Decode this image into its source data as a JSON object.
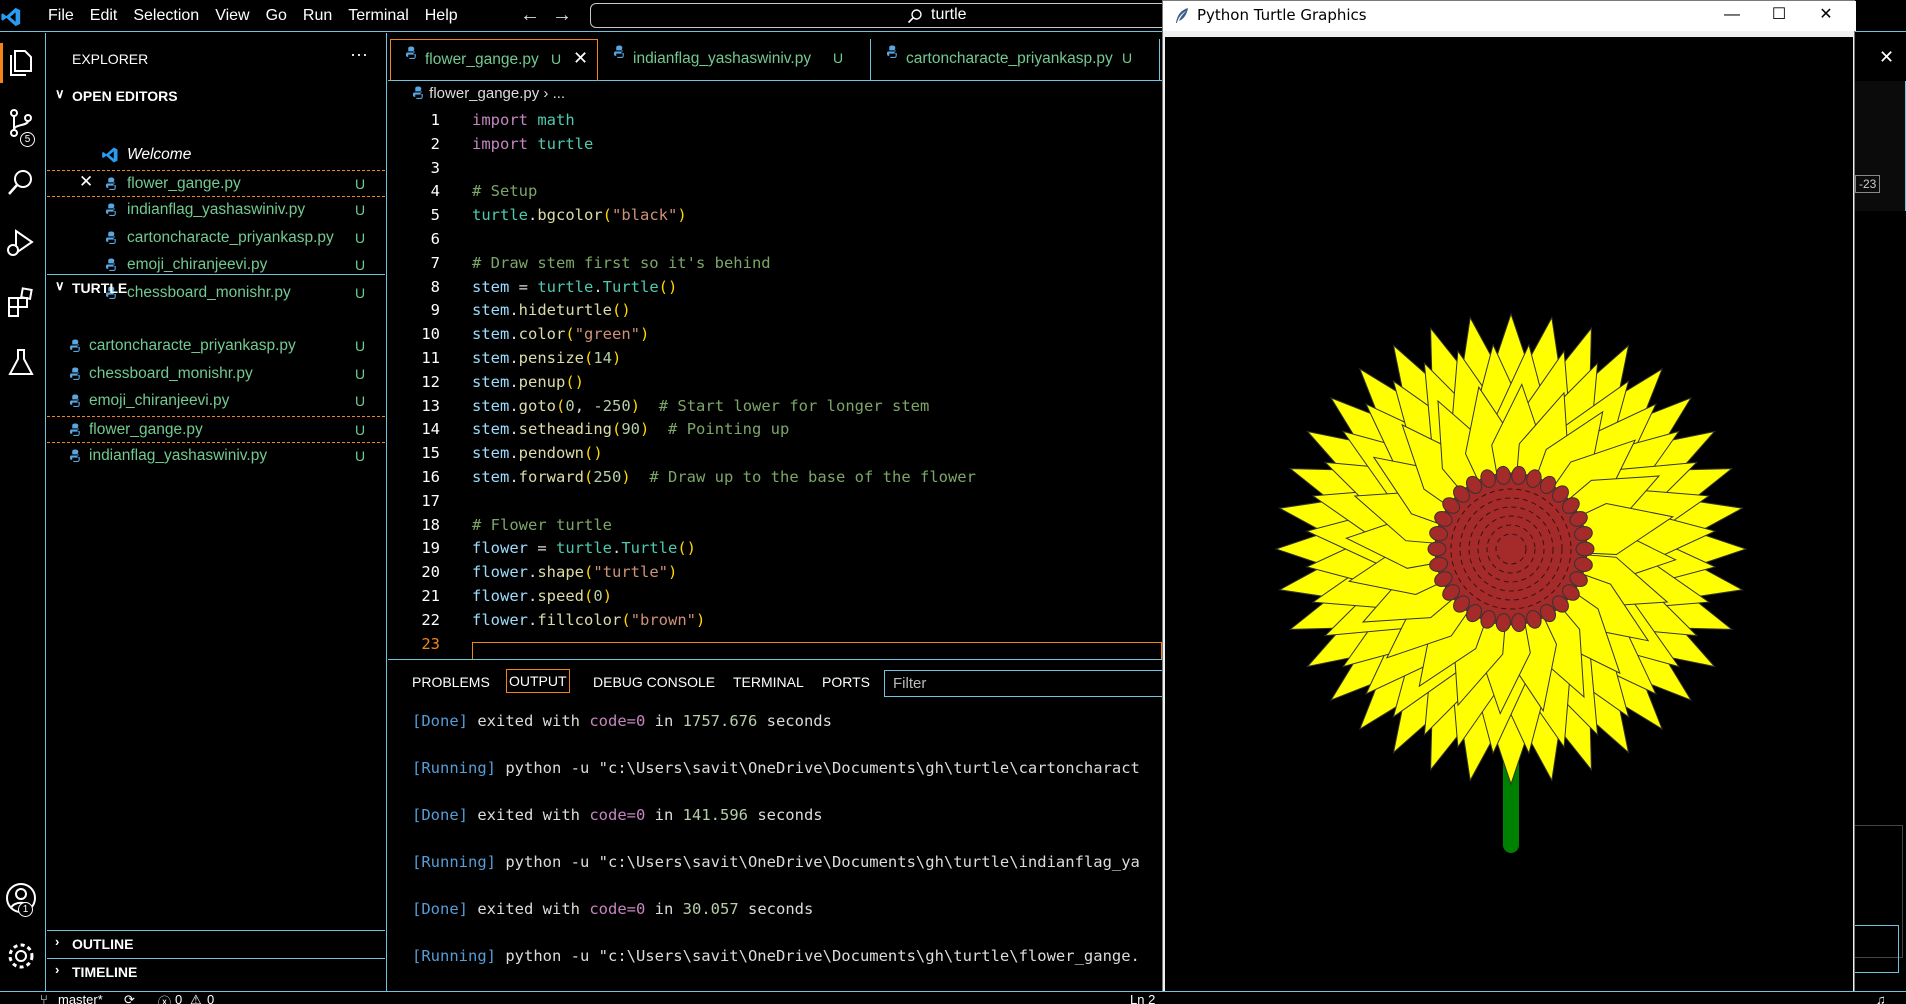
{
  "menu": [
    "File",
    "Edit",
    "Selection",
    "View",
    "Go",
    "Run",
    "Terminal",
    "Help"
  ],
  "search": {
    "value": "turtle"
  },
  "activity": {
    "source_control_badge": "5",
    "account_badge": "1"
  },
  "explorer": {
    "title": "EXPLORER",
    "more": "···",
    "open_editors": {
      "label": "OPEN EDITORS",
      "items": [
        {
          "name": "Welcome",
          "status": ""
        },
        {
          "name": "flower_gange.py",
          "status": "U"
        },
        {
          "name": "indianflag_yashaswiniv.py",
          "status": "U"
        },
        {
          "name": "cartoncharacte_priyankasp.py",
          "status": "U"
        },
        {
          "name": "emoji_chiranjeevi.py",
          "status": "U"
        },
        {
          "name": "chessboard_monishr.py",
          "status": "U"
        }
      ]
    },
    "folder": {
      "label": "TURTLE",
      "items": [
        {
          "name": "cartoncharacte_priyankasp.py",
          "status": "U"
        },
        {
          "name": "chessboard_monishr.py",
          "status": "U"
        },
        {
          "name": "emoji_chiranjeevi.py",
          "status": "U"
        },
        {
          "name": "flower_gange.py",
          "status": "U"
        },
        {
          "name": "indianflag_yashaswiniv.py",
          "status": "U"
        }
      ]
    },
    "outline": "OUTLINE",
    "timeline": "TIMELINE"
  },
  "tabs": [
    {
      "name": "flower_gange.py",
      "status": "U",
      "active": true
    },
    {
      "name": "indianflag_yashaswiniv.py",
      "status": "U",
      "active": false
    },
    {
      "name": "cartoncharacte_priyankasp.py",
      "status": "U",
      "active": false
    }
  ],
  "breadcrumb": {
    "file": "flower_gange.py",
    "sep": "›",
    "more": "..."
  },
  "code": {
    "line_numbers": [
      "1",
      "2",
      "3",
      "4",
      "5",
      "6",
      "7",
      "8",
      "9",
      "10",
      "11",
      "12",
      "13",
      "14",
      "15",
      "16",
      "17",
      "18",
      "19",
      "20",
      "21",
      "22",
      "23"
    ],
    "current_line": "23",
    "lines": [
      [
        [
          "kw",
          "import"
        ],
        [
          "pl",
          " "
        ],
        [
          "cls",
          "math"
        ]
      ],
      [
        [
          "kw",
          "import"
        ],
        [
          "pl",
          " "
        ],
        [
          "cls",
          "turtle"
        ]
      ],
      [],
      [
        [
          "cm",
          "# Setup"
        ]
      ],
      [
        [
          "cls",
          "turtle"
        ],
        [
          "pl",
          "."
        ],
        [
          "fn",
          "bgcolor"
        ],
        [
          "brk",
          "("
        ],
        [
          "str",
          "\"black\""
        ],
        [
          "brk",
          ")"
        ]
      ],
      [],
      [
        [
          "cm",
          "# Draw stem first so it's behind"
        ]
      ],
      [
        [
          "var",
          "stem"
        ],
        [
          "pl",
          " = "
        ],
        [
          "cls",
          "turtle"
        ],
        [
          "pl",
          "."
        ],
        [
          "cls",
          "Turtle"
        ],
        [
          "brk",
          "()"
        ]
      ],
      [
        [
          "var",
          "stem"
        ],
        [
          "pl",
          "."
        ],
        [
          "fn",
          "hideturtle"
        ],
        [
          "brk",
          "()"
        ]
      ],
      [
        [
          "var",
          "stem"
        ],
        [
          "pl",
          "."
        ],
        [
          "fn",
          "color"
        ],
        [
          "brk",
          "("
        ],
        [
          "str",
          "\"green\""
        ],
        [
          "brk",
          ")"
        ]
      ],
      [
        [
          "var",
          "stem"
        ],
        [
          "pl",
          "."
        ],
        [
          "fn",
          "pensize"
        ],
        [
          "brk",
          "("
        ],
        [
          "num",
          "14"
        ],
        [
          "brk",
          ")"
        ]
      ],
      [
        [
          "var",
          "stem"
        ],
        [
          "pl",
          "."
        ],
        [
          "fn",
          "penup"
        ],
        [
          "brk",
          "()"
        ]
      ],
      [
        [
          "var",
          "stem"
        ],
        [
          "pl",
          "."
        ],
        [
          "fn",
          "goto"
        ],
        [
          "brk",
          "("
        ],
        [
          "num",
          "0"
        ],
        [
          "pl",
          ", "
        ],
        [
          "num",
          "-250"
        ],
        [
          "brk",
          ")"
        ],
        [
          "pl",
          "  "
        ],
        [
          "cm",
          "# Start lower for longer stem"
        ]
      ],
      [
        [
          "var",
          "stem"
        ],
        [
          "pl",
          "."
        ],
        [
          "fn",
          "setheading"
        ],
        [
          "brk",
          "("
        ],
        [
          "num",
          "90"
        ],
        [
          "brk",
          ")"
        ],
        [
          "pl",
          "  "
        ],
        [
          "cm",
          "# Pointing up"
        ]
      ],
      [
        [
          "var",
          "stem"
        ],
        [
          "pl",
          "."
        ],
        [
          "fn",
          "pendown"
        ],
        [
          "brk",
          "()"
        ]
      ],
      [
        [
          "var",
          "stem"
        ],
        [
          "pl",
          "."
        ],
        [
          "fn",
          "forward"
        ],
        [
          "brk",
          "("
        ],
        [
          "num",
          "250"
        ],
        [
          "brk",
          ")"
        ],
        [
          "pl",
          "  "
        ],
        [
          "cm",
          "# Draw up to the base of the flower"
        ]
      ],
      [],
      [
        [
          "cm",
          "# Flower turtle"
        ]
      ],
      [
        [
          "var",
          "flower"
        ],
        [
          "pl",
          " = "
        ],
        [
          "cls",
          "turtle"
        ],
        [
          "pl",
          "."
        ],
        [
          "cls",
          "Turtle"
        ],
        [
          "brk",
          "()"
        ]
      ],
      [
        [
          "var",
          "flower"
        ],
        [
          "pl",
          "."
        ],
        [
          "fn",
          "shape"
        ],
        [
          "brk",
          "("
        ],
        [
          "str",
          "\"turtle\""
        ],
        [
          "brk",
          ")"
        ]
      ],
      [
        [
          "var",
          "flower"
        ],
        [
          "pl",
          "."
        ],
        [
          "fn",
          "speed"
        ],
        [
          "brk",
          "("
        ],
        [
          "num",
          "0"
        ],
        [
          "brk",
          ")"
        ]
      ],
      [
        [
          "var",
          "flower"
        ],
        [
          "pl",
          "."
        ],
        [
          "fn",
          "fillcolor"
        ],
        [
          "brk",
          "("
        ],
        [
          "str",
          "\"brown\""
        ],
        [
          "brk",
          ")"
        ]
      ],
      []
    ]
  },
  "panel": {
    "tabs": [
      "PROBLEMS",
      "OUTPUT",
      "DEBUG CONSOLE",
      "TERMINAL",
      "PORTS"
    ],
    "filter_placeholder": "Filter",
    "output": [
      [
        [
          "o-tag",
          "[Done]"
        ],
        [
          "pl",
          " exited with "
        ],
        [
          "o-ex",
          "code=0"
        ],
        [
          "pl",
          " in "
        ],
        [
          "o-num",
          "1757.676"
        ],
        [
          "pl",
          " seconds"
        ]
      ],
      [
        [
          "o-tag",
          "[Running]"
        ],
        [
          "pl",
          " python -u \"c:\\Users\\savit\\OneDrive\\Documents\\gh\\turtle\\cartoncharact"
        ]
      ],
      [
        [
          "o-tag",
          "[Done]"
        ],
        [
          "pl",
          " exited with "
        ],
        [
          "o-ex",
          "code=0"
        ],
        [
          "pl",
          " in "
        ],
        [
          "o-num",
          "141.596"
        ],
        [
          "pl",
          " seconds"
        ]
      ],
      [
        [
          "o-tag",
          "[Running]"
        ],
        [
          "pl",
          " python -u \"c:\\Users\\savit\\OneDrive\\Documents\\gh\\turtle\\indianflag_ya"
        ]
      ],
      [
        [
          "o-tag",
          "[Done]"
        ],
        [
          "pl",
          " exited with "
        ],
        [
          "o-ex",
          "code=0"
        ],
        [
          "pl",
          " in "
        ],
        [
          "o-num",
          "30.057"
        ],
        [
          "pl",
          " seconds"
        ]
      ],
      [
        [
          "o-tag",
          "[Running]"
        ],
        [
          "pl",
          " python -u \"c:\\Users\\savit\\OneDrive\\Documents\\gh\\turtle\\flower_gange."
        ]
      ]
    ]
  },
  "status": {
    "branch": "master*",
    "errors": "0",
    "warnings": "0",
    "position": "Ln 2"
  },
  "right_strip": {
    "snippet": "-23"
  },
  "turtle_window": {
    "title": "Python Turtle Graphics",
    "minimize": "—",
    "maximize": "☐",
    "close": "✕",
    "colors": {
      "background": "#000000",
      "petal": "#ffff00",
      "center": "#a52a2a",
      "stem": "#008000"
    }
  }
}
